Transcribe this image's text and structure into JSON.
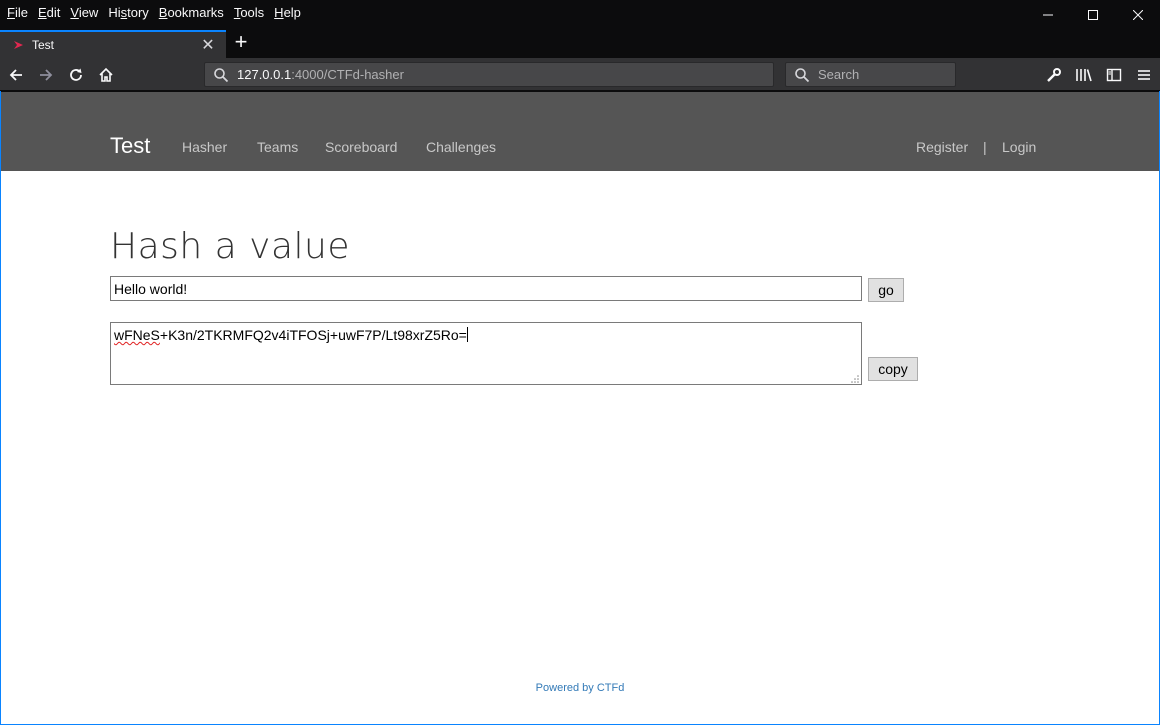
{
  "menu": {
    "items": [
      {
        "key": "F",
        "rest": "ile"
      },
      {
        "key": "E",
        "rest": "dit"
      },
      {
        "key": "V",
        "rest": "iew"
      },
      {
        "pre": "Hi",
        "key": "s",
        "rest": "tory"
      },
      {
        "key": "B",
        "rest": "ookmarks"
      },
      {
        "key": "T",
        "rest": "ools"
      },
      {
        "key": "H",
        "rest": "elp"
      }
    ]
  },
  "tab": {
    "title": "Test",
    "close": "✕",
    "new_tab": "+"
  },
  "urlbar": {
    "host": "127.0.0.1",
    "path": ":4000/CTFd-hasher"
  },
  "searchbar": {
    "placeholder": "Search"
  },
  "site": {
    "brand": "Test",
    "nav": [
      "Hasher",
      "Teams",
      "Scoreboard",
      "Challenges"
    ],
    "register": "Register",
    "separator": "|",
    "login": "Login"
  },
  "hasher": {
    "title": "Hash a value",
    "input_value": "Hello world!",
    "go_label": "go",
    "output_spell": "wFNeS",
    "output_rest": "+K3n/2TKRMFQ2v4iTFOSj+uwF7P/Lt98xrZ5Ro=",
    "copy_label": "copy"
  },
  "footer": {
    "text": "Powered by CTFd"
  },
  "colors": {
    "accent": "#0a84ff",
    "site_nav_bg": "#555555",
    "link": "#337ab7"
  }
}
